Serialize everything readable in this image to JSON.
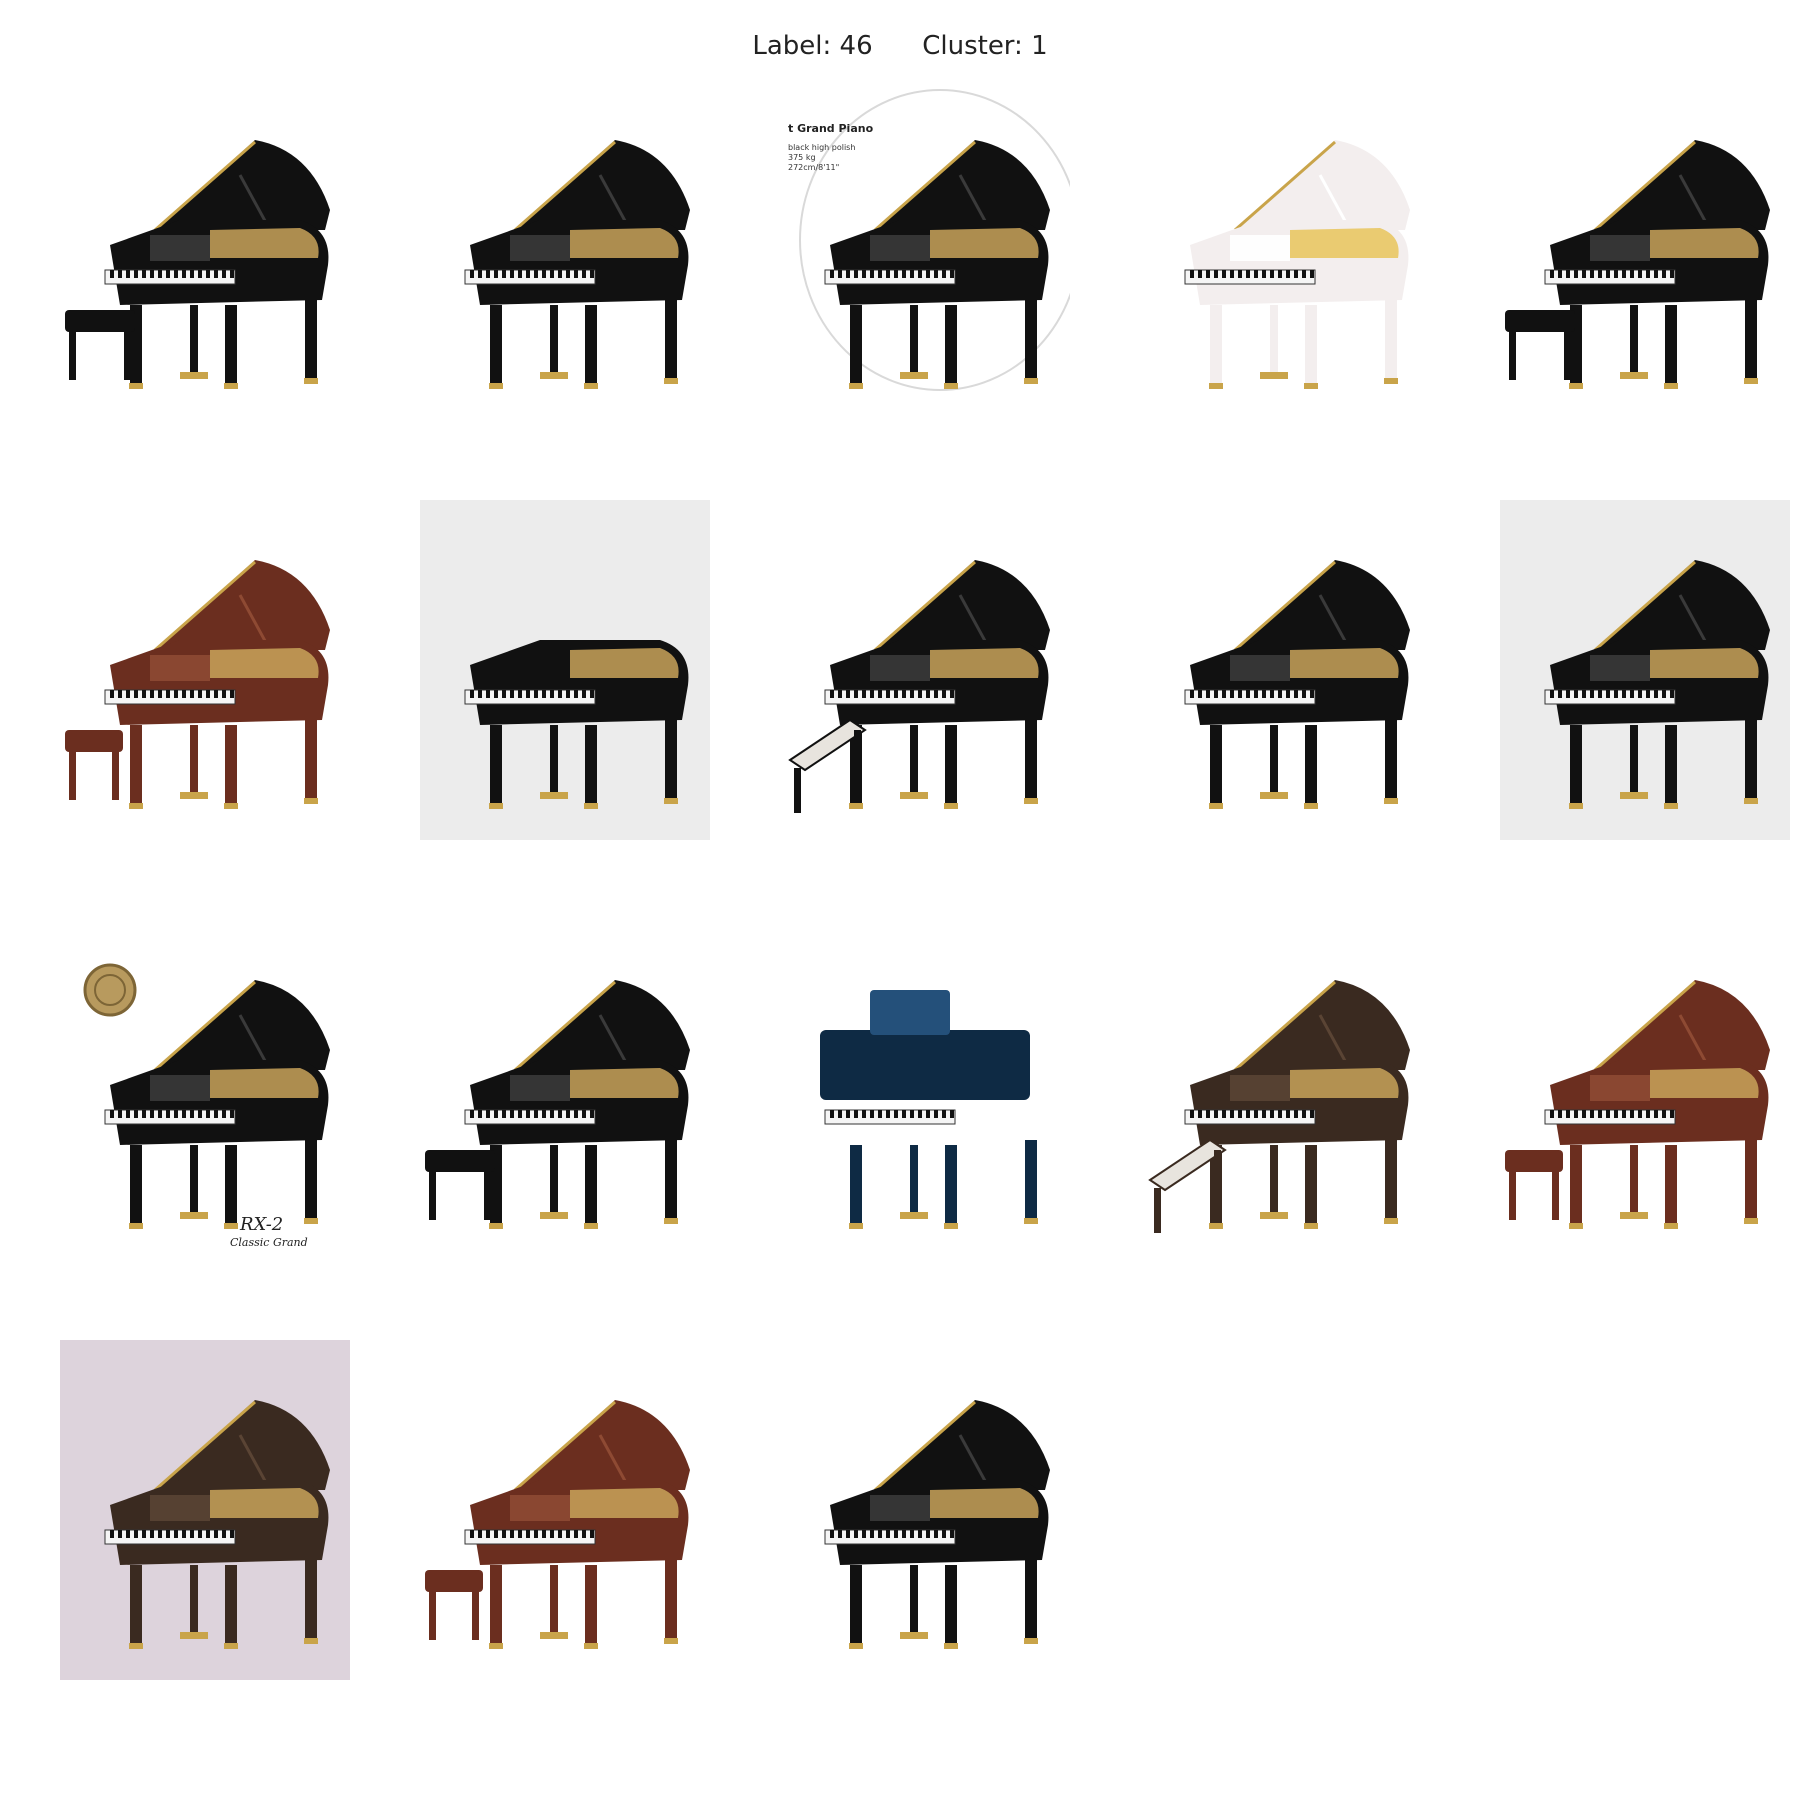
{
  "figure": {
    "label": "46",
    "cluster": "1",
    "label_prefix": "Label:",
    "cluster_prefix": "Cluster:"
  },
  "colors": {
    "background": "#ffffff",
    "black_lacquer": "#111111",
    "white_lacquer": "#f3eeee",
    "mahogany": "#6b2e1f",
    "walnut": "#3a2a20",
    "navy": "#0e2a44",
    "gold": "#c9a44a"
  },
  "pianos": [
    {
      "row": 0,
      "col": 0,
      "finish": "black",
      "bench": "square-stool",
      "backdrop": "none"
    },
    {
      "row": 0,
      "col": 1,
      "finish": "black",
      "bench": "none",
      "backdrop": "none"
    },
    {
      "row": 0,
      "col": 2,
      "finish": "black",
      "bench": "none",
      "backdrop": "circle",
      "caption_lines": [
        "t Grand Piano",
        "black high polish",
        "375 kg",
        "272cm/8'11\""
      ]
    },
    {
      "row": 0,
      "col": 3,
      "finish": "white",
      "bench": "none",
      "backdrop": "none"
    },
    {
      "row": 0,
      "col": 4,
      "finish": "black",
      "bench": "square-stool",
      "backdrop": "none"
    },
    {
      "row": 1,
      "col": 0,
      "finish": "mahogany",
      "bench": "small-stool",
      "backdrop": "none"
    },
    {
      "row": 1,
      "col": 1,
      "finish": "black",
      "bench": "none",
      "backdrop": "light-grey",
      "lid": "closed"
    },
    {
      "row": 1,
      "col": 2,
      "finish": "black",
      "bench": "long-bench",
      "backdrop": "none"
    },
    {
      "row": 1,
      "col": 3,
      "finish": "black",
      "bench": "none",
      "backdrop": "none"
    },
    {
      "row": 1,
      "col": 4,
      "finish": "black",
      "bench": "none",
      "backdrop": "light-grey"
    },
    {
      "row": 2,
      "col": 0,
      "finish": "black",
      "bench": "none",
      "backdrop": "none",
      "medallion": true,
      "caption_lines": [
        "RX-2",
        "Classic Grand"
      ]
    },
    {
      "row": 2,
      "col": 1,
      "finish": "black",
      "bench": "square-stool",
      "backdrop": "none"
    },
    {
      "row": 2,
      "col": 2,
      "finish": "navy",
      "bench": "none",
      "backdrop": "none",
      "lid": "closed-upright-style"
    },
    {
      "row": 2,
      "col": 3,
      "finish": "walnut",
      "bench": "long-bench",
      "backdrop": "none"
    },
    {
      "row": 2,
      "col": 4,
      "finish": "mahogany",
      "bench": "small-stool",
      "backdrop": "none"
    },
    {
      "row": 3,
      "col": 0,
      "finish": "walnut",
      "bench": "none",
      "backdrop": "lavender"
    },
    {
      "row": 3,
      "col": 1,
      "finish": "mahogany",
      "bench": "small-stool",
      "backdrop": "none"
    },
    {
      "row": 3,
      "col": 2,
      "finish": "black",
      "bench": "none",
      "backdrop": "none"
    }
  ]
}
